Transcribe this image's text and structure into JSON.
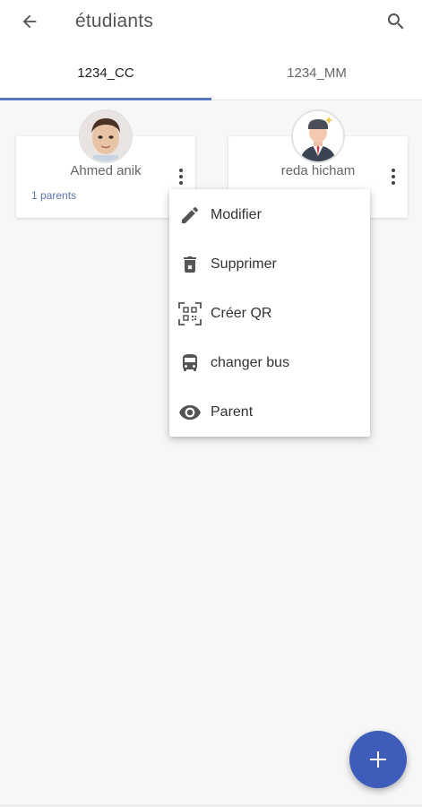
{
  "appbar": {
    "title": "étudiants",
    "back_icon": "arrow-left-icon",
    "search_icon": "search-icon"
  },
  "tabs": [
    {
      "label": "1234_CC",
      "active": true
    },
    {
      "label": "1234_MM",
      "active": false
    }
  ],
  "students": [
    {
      "name": "Ahmed anik",
      "parents": "1 parents",
      "avatar": "child-photo-avatar"
    },
    {
      "name": "reda hicham",
      "parents": "",
      "avatar": "businessman-avatar"
    }
  ],
  "menu": {
    "items": [
      {
        "label": "Modifier",
        "icon": "pencil-icon"
      },
      {
        "label": "Supprimer",
        "icon": "trash-icon"
      },
      {
        "label": "Créer QR",
        "icon": "qr-code-icon"
      },
      {
        "label": "changer bus",
        "icon": "bus-icon"
      },
      {
        "label": "Parent",
        "icon": "eye-icon"
      }
    ]
  },
  "fab": {
    "icon": "plus-icon"
  },
  "colors": {
    "accent": "#3e5dbb",
    "tab_indicator": "#5b77c6",
    "link": "#5b74b8",
    "background": "#f7f7f8"
  }
}
